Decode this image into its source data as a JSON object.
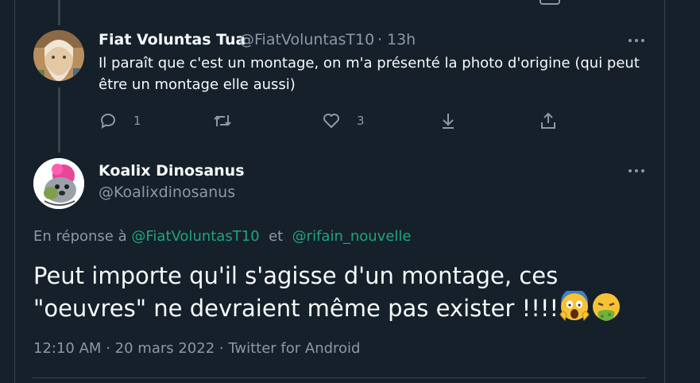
{
  "tweet1": {
    "name": "Fiat Voluntas Tua",
    "handle": "@FiatVoluntasT10",
    "separator": "·",
    "time": "13h",
    "text": "Il paraît que c'est un montage, on m'a présenté la photo d'origine (qui peut être un montage elle aussi)",
    "reply_count": "1",
    "retweet_count": "",
    "like_count": "3"
  },
  "tweet2": {
    "name": "Koalix Dinosanus",
    "handle": "@Koalixdinosanus",
    "reply_prefix": "En réponse à",
    "mention1": "@FiatVoluntasT10",
    "conjunction": "et",
    "mention2": "@rifain_nouvelle",
    "text": "Peut importe qu'il s'agisse d'un montage, ces \"oeuvres\" ne devraient même pas exister !!!!",
    "emojis": [
      "screaming-face-emoji",
      "vomiting-face-emoji"
    ],
    "time": "12:10 AM",
    "date": "20 mars 2022",
    "source": "Twitter for Android",
    "separator": "·"
  },
  "colors": {
    "background": "#15202b",
    "border": "#38444d",
    "secondary_text": "#8b98a5",
    "mention": "#1fa57a"
  }
}
